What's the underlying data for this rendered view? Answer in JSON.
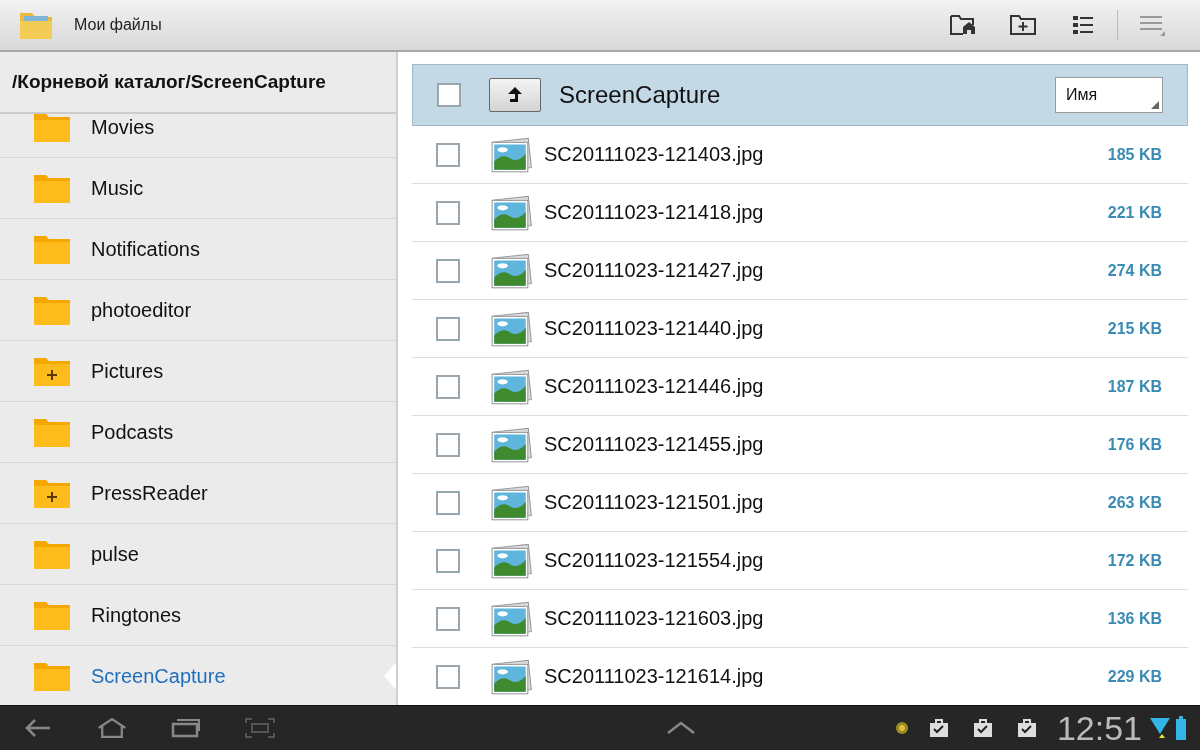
{
  "app_bar": {
    "title": "Мои файлы"
  },
  "path": "/Корневой каталог/ScreenCapture",
  "folders": [
    {
      "name": "Movies",
      "kind": "plain",
      "selected": false
    },
    {
      "name": "Music",
      "kind": "plain",
      "selected": false
    },
    {
      "name": "Notifications",
      "kind": "plain",
      "selected": false
    },
    {
      "name": "photoeditor",
      "kind": "plain",
      "selected": false
    },
    {
      "name": "Pictures",
      "kind": "plus",
      "selected": false
    },
    {
      "name": "Podcasts",
      "kind": "plain",
      "selected": false
    },
    {
      "name": "PressReader",
      "kind": "plus",
      "selected": false
    },
    {
      "name": "pulse",
      "kind": "plain",
      "selected": false
    },
    {
      "name": "Ringtones",
      "kind": "plain",
      "selected": false
    },
    {
      "name": "ScreenCapture",
      "kind": "plain",
      "selected": true
    }
  ],
  "header": {
    "title": "ScreenCapture",
    "checked": false,
    "sort": "Имя"
  },
  "files": [
    {
      "name": "SC20111023-121403.jpg",
      "size": "185 KB",
      "checked": false
    },
    {
      "name": "SC20111023-121418.jpg",
      "size": "221 KB",
      "checked": false
    },
    {
      "name": "SC20111023-121427.jpg",
      "size": "274 KB",
      "checked": false
    },
    {
      "name": "SC20111023-121440.jpg",
      "size": "215 KB",
      "checked": false
    },
    {
      "name": "SC20111023-121446.jpg",
      "size": "187 KB",
      "checked": false
    },
    {
      "name": "SC20111023-121455.jpg",
      "size": "176 KB",
      "checked": false
    },
    {
      "name": "SC20111023-121501.jpg",
      "size": "263 KB",
      "checked": false
    },
    {
      "name": "SC20111023-121554.jpg",
      "size": "172 KB",
      "checked": false
    },
    {
      "name": "SC20111023-121603.jpg",
      "size": "136 KB",
      "checked": false
    },
    {
      "name": "SC20111023-121614.jpg",
      "size": "229 KB",
      "checked": false
    }
  ],
  "system_bar": {
    "time": "12:51"
  }
}
